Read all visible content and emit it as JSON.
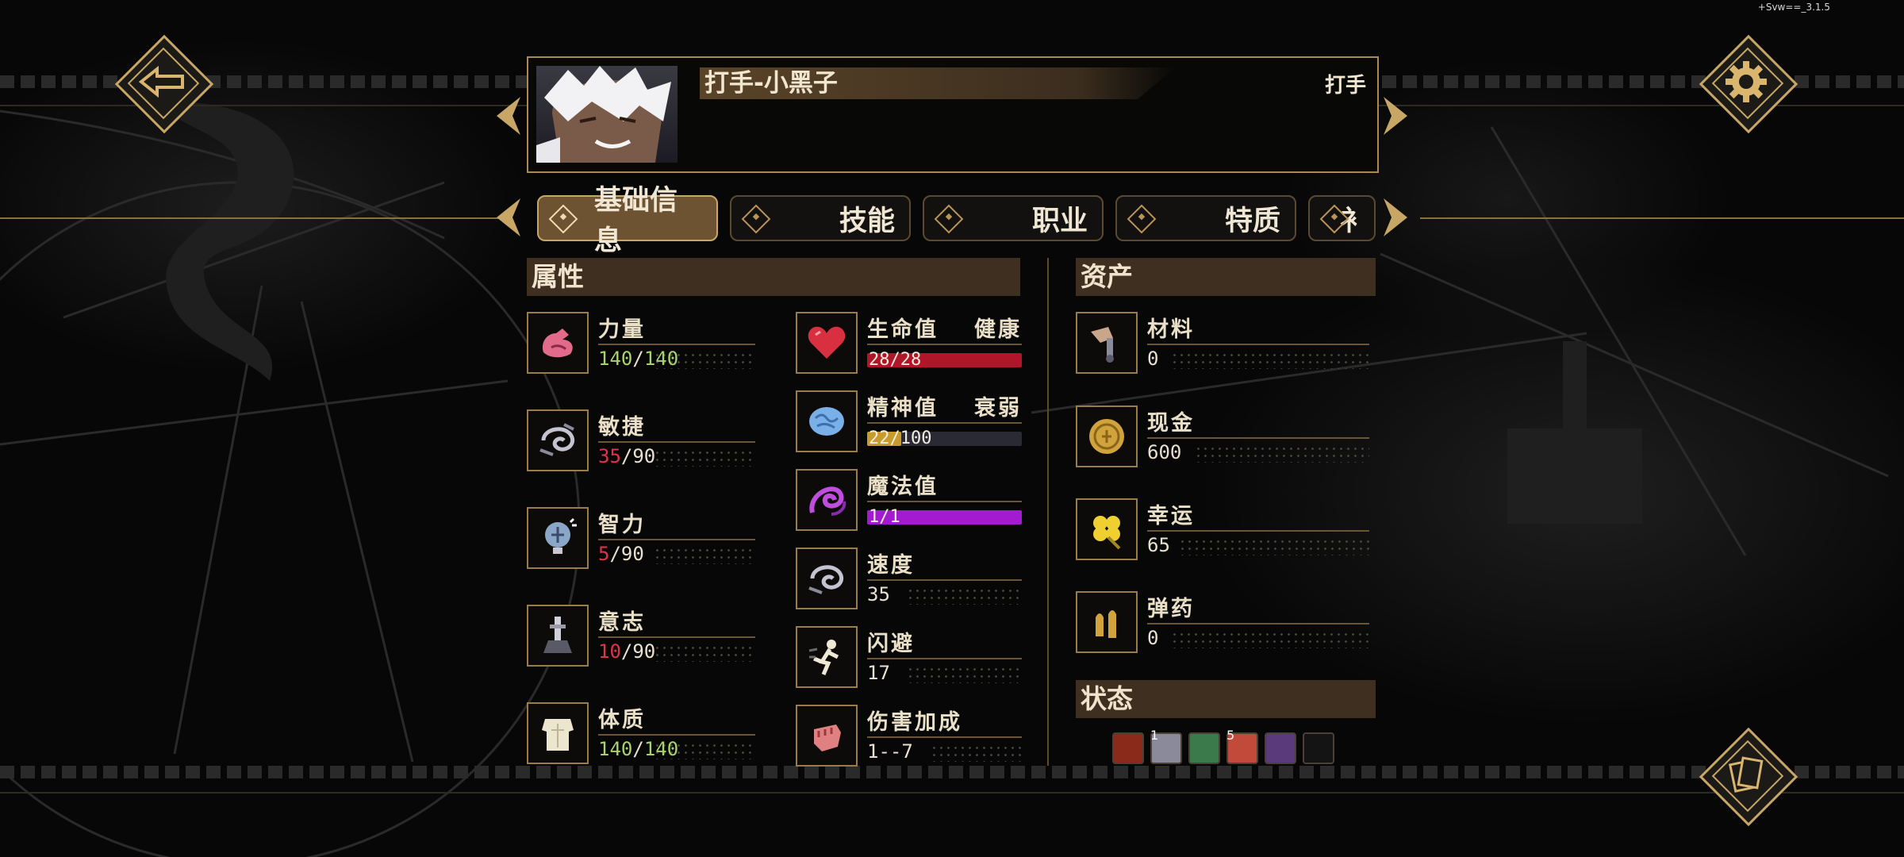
{
  "version": "+Svw==_3.1.5",
  "character": {
    "name": "打手-小黑子",
    "class": "打手"
  },
  "tabs": [
    {
      "label": "基础信息",
      "active": true
    },
    {
      "label": "技能",
      "active": false
    },
    {
      "label": "职业",
      "active": false
    },
    {
      "label": "特质",
      "active": false
    },
    {
      "label": "衤",
      "active": false
    }
  ],
  "attributes": {
    "title": "属性",
    "items": [
      {
        "label": "力量",
        "current": "140",
        "max": "140",
        "current_color": "#a7d46a",
        "icon": "muscle-arm-icon"
      },
      {
        "label": "敏捷",
        "current": "35",
        "max": "90",
        "current_color": "#e0344a",
        "icon": "wind-swirl-icon"
      },
      {
        "label": "智力",
        "current": "5",
        "max": "90",
        "current_color": "#e0344a",
        "icon": "brain-bulb-icon"
      },
      {
        "label": "意志",
        "current": "10",
        "max": "90",
        "current_color": "#e0344a",
        "icon": "sword-altar-icon"
      },
      {
        "label": "体质",
        "current": "140",
        "max": "140",
        "current_color": "#a7d46a",
        "icon": "torso-icon"
      }
    ]
  },
  "vitals": {
    "hp": {
      "label": "生命值",
      "status": "健康",
      "current": "28",
      "max": "28",
      "fill": 1.0,
      "color": "#b0162a",
      "icon": "heart-icon"
    },
    "sanity": {
      "label": "精神值",
      "status": "衰弱",
      "current": "22",
      "max": "100",
      "fill": 0.22,
      "color": "#c99b2c",
      "icon": "brain-icon"
    },
    "mana": {
      "label": "魔法值",
      "current": "1",
      "max": "1",
      "fill": 1.0,
      "color": "#a21bd0",
      "icon": "magic-swirl-icon"
    },
    "speed": {
      "label": "速度",
      "value": "35",
      "icon": "speed-icon"
    },
    "dodge": {
      "label": "闪避",
      "value": "17",
      "icon": "dodge-icon"
    },
    "damage": {
      "label": "伤害加成",
      "value": "1--7",
      "icon": "fist-icon"
    }
  },
  "assets": {
    "title": "资产",
    "items": [
      {
        "label": "材料",
        "value": "0",
        "icon": "materials-icon"
      },
      {
        "label": "现金",
        "value": "600",
        "icon": "coin-icon"
      },
      {
        "label": "幸运",
        "value": "65",
        "icon": "clover-icon"
      },
      {
        "label": "弹药",
        "value": "0",
        "icon": "ammo-icon"
      }
    ]
  },
  "status": {
    "title": "状态",
    "effects": [
      {
        "icon": "tree-status-icon",
        "count": "",
        "color": "#8a2a1a"
      },
      {
        "icon": "figure-status-icon",
        "count": "1",
        "color": "#8a8a9a"
      },
      {
        "icon": "sparkle-status-icon",
        "count": "",
        "color": "#3b7a4a"
      },
      {
        "icon": "book-status-icon",
        "count": "5",
        "color": "#c24a3a"
      },
      {
        "icon": "potion-status-icon",
        "count": "",
        "color": "#5a3a7a"
      },
      {
        "icon": "empty-status-slot",
        "count": "",
        "color": "#1a1a1a"
      }
    ]
  }
}
